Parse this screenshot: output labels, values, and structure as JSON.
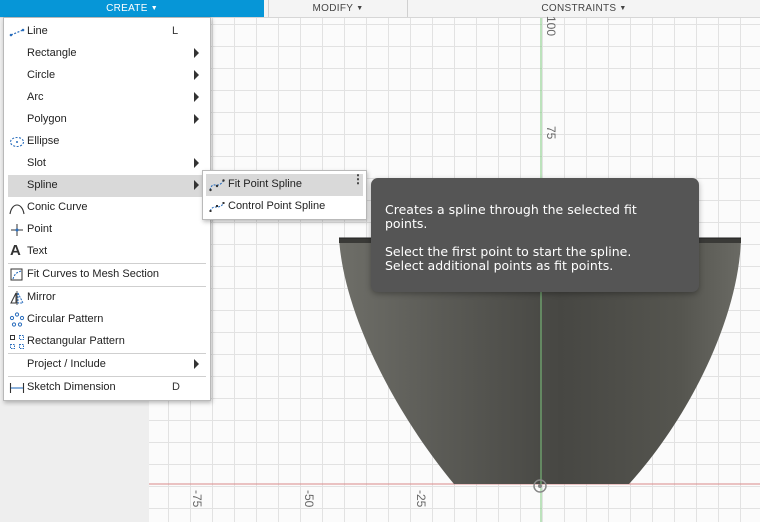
{
  "toolbar": {
    "create_label": "CREATE",
    "modify_label": "MODIFY",
    "constraints_label": "CONSTRAINTS"
  },
  "create_menu": {
    "items": [
      {
        "label": "Line",
        "shortcut": "L",
        "icon": "line-icon"
      },
      {
        "label": "Rectangle",
        "icon": "none"
      },
      {
        "label": "Circle",
        "icon": "none"
      },
      {
        "label": "Arc",
        "icon": "none"
      },
      {
        "label": "Polygon",
        "icon": "none"
      },
      {
        "label": "Ellipse",
        "icon": "ellipse-icon"
      },
      {
        "label": "Slot",
        "icon": "none"
      },
      {
        "label": "Spline",
        "icon": "none"
      },
      {
        "label": "Conic Curve",
        "icon": "conic-curve-icon"
      },
      {
        "label": "Point",
        "icon": "point-icon"
      },
      {
        "label": "Text",
        "icon": "text-icon"
      },
      {
        "label": "Fit Curves to Mesh Section",
        "icon": "fit-curves-icon"
      },
      {
        "label": "Mirror",
        "icon": "mirror-icon"
      },
      {
        "label": "Circular Pattern",
        "icon": "circular-pattern-icon"
      },
      {
        "label": "Rectangular Pattern",
        "icon": "rectangular-pattern-icon"
      },
      {
        "label": "Project / Include",
        "icon": "none"
      },
      {
        "label": "Sketch Dimension",
        "shortcut": "D",
        "icon": "sketch-dimension-icon"
      }
    ]
  },
  "spline_submenu": {
    "items": [
      {
        "label": "Fit Point Spline",
        "icon": "fit-point-spline-icon"
      },
      {
        "label": "Control Point Spline",
        "icon": "control-point-spline-icon"
      }
    ]
  },
  "tooltip": {
    "line1": "Creates a spline through the selected fit points.",
    "line2": "Select the first point to start the spline.",
    "line3": "Select additional points as fit points."
  },
  "axis_labels": {
    "v_top": "100",
    "v_75": "75",
    "h_m75": "-75",
    "h_m50": "-50",
    "h_m25": "-25"
  },
  "colors": {
    "accent": "#0696d7",
    "tooltip_bg": "#555555",
    "axis_green": "#7ec87e",
    "axis_red": "#d98a8a",
    "model_dark": "#4a4a46"
  }
}
